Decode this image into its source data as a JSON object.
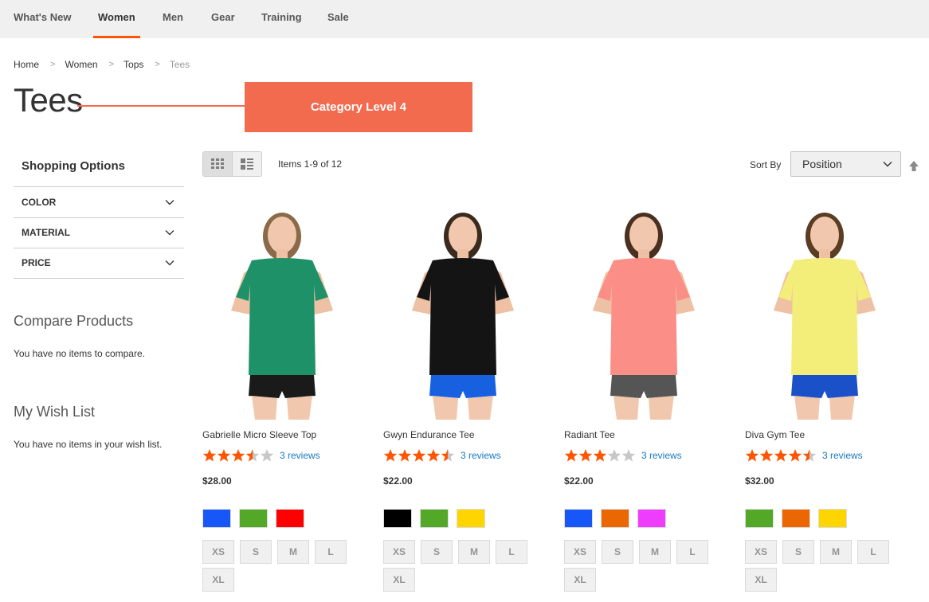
{
  "nav": {
    "items": [
      {
        "label": "What's New",
        "active": false
      },
      {
        "label": "Women",
        "active": true
      },
      {
        "label": "Men",
        "active": false
      },
      {
        "label": "Gear",
        "active": false
      },
      {
        "label": "Training",
        "active": false
      },
      {
        "label": "Sale",
        "active": false
      }
    ]
  },
  "breadcrumb": [
    "Home",
    "Women",
    "Tops",
    "Tees"
  ],
  "page_title": "Tees",
  "annotation": {
    "label": "Category Level 4",
    "color": "#f26b4f"
  },
  "sidebar": {
    "title": "Shopping Options",
    "filters": [
      "COLOR",
      "MATERIAL",
      "PRICE"
    ],
    "compare": {
      "heading": "Compare Products",
      "text": "You have no items to compare."
    },
    "wishlist": {
      "heading": "My Wish List",
      "text": "You have no items in your wish list."
    }
  },
  "toolbar": {
    "modes": [
      "grid-icon",
      "list-icon"
    ],
    "items_count": "Items 1-9 of 12",
    "sort_label": "Sort By",
    "sort_value": "Position"
  },
  "colors": {
    "accent": "#ff5501",
    "star": "#ff5501",
    "star_empty": "#c7c7c7",
    "link": "#1979c3"
  },
  "products": [
    {
      "name": "Gabrielle Micro Sleeve Top",
      "rating": 3.5,
      "reviews": "3 reviews",
      "price": "$28.00",
      "shirt": "#1e9168",
      "bottom": "#1a1a1a",
      "hair": "#8a6a48",
      "swatches": [
        "#1857f7",
        "#53a828",
        "#ff0000"
      ],
      "sizes": [
        "XS",
        "S",
        "M",
        "L",
        "XL"
      ]
    },
    {
      "name": "Gwyn Endurance Tee",
      "rating": 4.5,
      "reviews": "3 reviews",
      "price": "$22.00",
      "shirt": "#141414",
      "bottom": "#1760e0",
      "hair": "#3b2a1e",
      "swatches": [
        "#000000",
        "#53a828",
        "#ffd500"
      ],
      "sizes": [
        "XS",
        "S",
        "M",
        "L",
        "XL"
      ]
    },
    {
      "name": "Radiant Tee",
      "rating": 3,
      "reviews": "3 reviews",
      "price": "$22.00",
      "shirt": "#fb8e86",
      "bottom": "#555555",
      "hair": "#4a3020",
      "swatches": [
        "#1857f7",
        "#eb6703",
        "#ef3dff"
      ],
      "sizes": [
        "XS",
        "S",
        "M",
        "L",
        "XL"
      ]
    },
    {
      "name": "Diva Gym Tee",
      "rating": 4.5,
      "reviews": "3 reviews",
      "price": "$32.00",
      "shirt": "#f3ee7a",
      "bottom": "#1a50c8",
      "hair": "#5a3d22",
      "swatches": [
        "#53a828",
        "#eb6703",
        "#ffd500"
      ],
      "sizes": [
        "XS",
        "S",
        "M",
        "L",
        "XL"
      ]
    }
  ]
}
